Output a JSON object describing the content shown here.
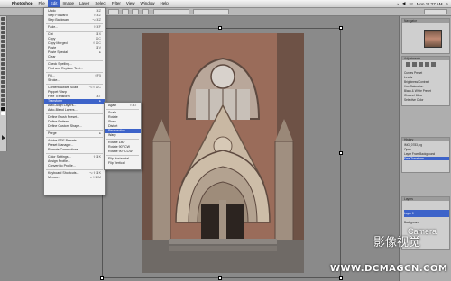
{
  "menubar": {
    "app": "Photoshop",
    "items": [
      "File",
      "Edit",
      "Image",
      "Layer",
      "Select",
      "Filter",
      "View",
      "Window",
      "Help"
    ],
    "active": "Edit",
    "clock": "Mon 11:27 AM",
    "status_icons": [
      "wifi-icon",
      "volume-icon",
      "battery-icon",
      "spotlight-icon"
    ]
  },
  "edit_menu": {
    "items": [
      {
        "label": "Undo",
        "shortcut": "⌘Z"
      },
      {
        "label": "Step Forward",
        "shortcut": "⇧⌘Z"
      },
      {
        "label": "Step Backward",
        "shortcut": "⌥⌘Z"
      },
      {
        "label": "Fade...",
        "shortcut": "⇧⌘F"
      },
      {
        "label": "Cut",
        "shortcut": "⌘X"
      },
      {
        "label": "Copy",
        "shortcut": "⌘C"
      },
      {
        "label": "Copy Merged",
        "shortcut": "⇧⌘C"
      },
      {
        "label": "Paste",
        "shortcut": "⌘V"
      },
      {
        "label": "Paste Special",
        "shortcut": "▸"
      },
      {
        "label": "Clear",
        "shortcut": ""
      },
      {
        "label": "Check Spelling...",
        "shortcut": ""
      },
      {
        "label": "Find and Replace Text...",
        "shortcut": ""
      },
      {
        "label": "Fill...",
        "shortcut": "⇧F5"
      },
      {
        "label": "Stroke...",
        "shortcut": ""
      },
      {
        "label": "Content-Aware Scale",
        "shortcut": "⌥⇧⌘C"
      },
      {
        "label": "Puppet Warp",
        "shortcut": ""
      },
      {
        "label": "Free Transform",
        "shortcut": "⌘T"
      },
      {
        "label": "Transform",
        "shortcut": "▸"
      },
      {
        "label": "Auto-Align Layers...",
        "shortcut": ""
      },
      {
        "label": "Auto-Blend Layers...",
        "shortcut": ""
      },
      {
        "label": "Define Brush Preset...",
        "shortcut": ""
      },
      {
        "label": "Define Pattern...",
        "shortcut": ""
      },
      {
        "label": "Define Custom Shape...",
        "shortcut": ""
      },
      {
        "label": "Purge",
        "shortcut": "▸"
      },
      {
        "label": "Adobe PDF Presets...",
        "shortcut": ""
      },
      {
        "label": "Preset Manager...",
        "shortcut": ""
      },
      {
        "label": "Remote Connections...",
        "shortcut": ""
      },
      {
        "label": "Color Settings...",
        "shortcut": "⇧⌘K"
      },
      {
        "label": "Assign Profile...",
        "shortcut": ""
      },
      {
        "label": "Convert to Profile...",
        "shortcut": ""
      },
      {
        "label": "Keyboard Shortcuts...",
        "shortcut": "⌥⇧⌘K"
      },
      {
        "label": "Menus...",
        "shortcut": "⌥⇧⌘M"
      }
    ],
    "highlighted": "Transform"
  },
  "transform_submenu": {
    "items": [
      "Again",
      "Scale",
      "Rotate",
      "Skew",
      "Distort",
      "Perspective",
      "Warp",
      "Rotate 180°",
      "Rotate 90° CW",
      "Rotate 90° CCW",
      "Flip Horizontal",
      "Flip Vertical"
    ],
    "shortcuts": [
      "⇧⌘T",
      "",
      "",
      "",
      "",
      "",
      "",
      "",
      "",
      "",
      "",
      ""
    ],
    "highlighted": "Perspective"
  },
  "panels": {
    "navigator_title": "Navigator",
    "adjustments_title": "Adjustments",
    "adjustment_rows": [
      "Curves Preset",
      "Levels",
      "Brightness/Contrast",
      "Hue/Saturation",
      "Black & White Preset",
      "Channel Mixer",
      "Selective Color"
    ],
    "history_title": "History",
    "history_rows": [
      "IMG_0783.jpg",
      "Open",
      "Layer From Background",
      "Free Transform"
    ],
    "layers_title": "Layers",
    "layer_rows": [
      "Layer 0",
      "Background"
    ]
  },
  "watermark": {
    "brand_cn": "影像视觉",
    "brand_en": "Camera",
    "url": "WWW.DCMAGCN.COM"
  }
}
